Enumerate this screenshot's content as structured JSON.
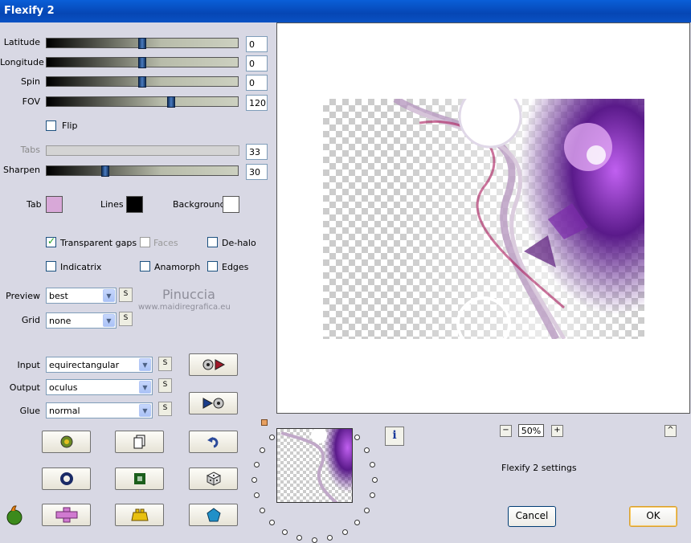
{
  "window": {
    "title": "Flexify 2"
  },
  "sliders": [
    {
      "label": "Latitude",
      "value": "0",
      "fraction": 0.5,
      "enabled": true
    },
    {
      "label": "Longitude",
      "value": "0",
      "fraction": 0.5,
      "enabled": true
    },
    {
      "label": "Spin",
      "value": "0",
      "fraction": 0.5,
      "enabled": true
    },
    {
      "label": "FOV",
      "value": "120",
      "fraction": 0.66,
      "enabled": true
    },
    {
      "label": "Tabs",
      "value": "33",
      "fraction": 0.33,
      "enabled": false
    },
    {
      "label": "Sharpen",
      "value": "30",
      "fraction": 0.3,
      "enabled": true
    }
  ],
  "flip": {
    "label": "Flip",
    "checked": false
  },
  "colors": {
    "tab": {
      "label": "Tab",
      "color": "#d8a8d8"
    },
    "lines": {
      "label": "Lines",
      "color": "#000000"
    },
    "background": {
      "label": "Background",
      "color": "#ffffff"
    }
  },
  "checkboxes": {
    "transparent_gaps": {
      "label": "Transparent gaps",
      "checked": true
    },
    "faces": {
      "label": "Faces",
      "checked": false
    },
    "dehalo": {
      "label": "De-halo",
      "checked": false
    },
    "indicatrix": {
      "label": "Indicatrix",
      "checked": false
    },
    "anamorph": {
      "label": "Anamorph",
      "checked": false
    },
    "edges": {
      "label": "Edges",
      "checked": false
    }
  },
  "preview_quality": {
    "label": "Preview",
    "value": "best",
    "s": "S"
  },
  "grid": {
    "label": "Grid",
    "value": "none",
    "s": "S"
  },
  "input": {
    "label": "Input",
    "value": "equirectangular",
    "s": "S"
  },
  "output": {
    "label": "Output",
    "value": "oculus",
    "s": "S"
  },
  "glue": {
    "label": "Glue",
    "value": "normal",
    "s": "S"
  },
  "watermark": {
    "name": "Pinuccia",
    "url": "www.maidiregrafica.eu"
  },
  "zoom": {
    "minus": "−",
    "value": "50%",
    "plus": "+"
  },
  "info_icon": "i",
  "collapse": "^",
  "settings_name": "Flexify 2 settings",
  "buttons": {
    "cancel": "Cancel",
    "ok": "OK"
  }
}
